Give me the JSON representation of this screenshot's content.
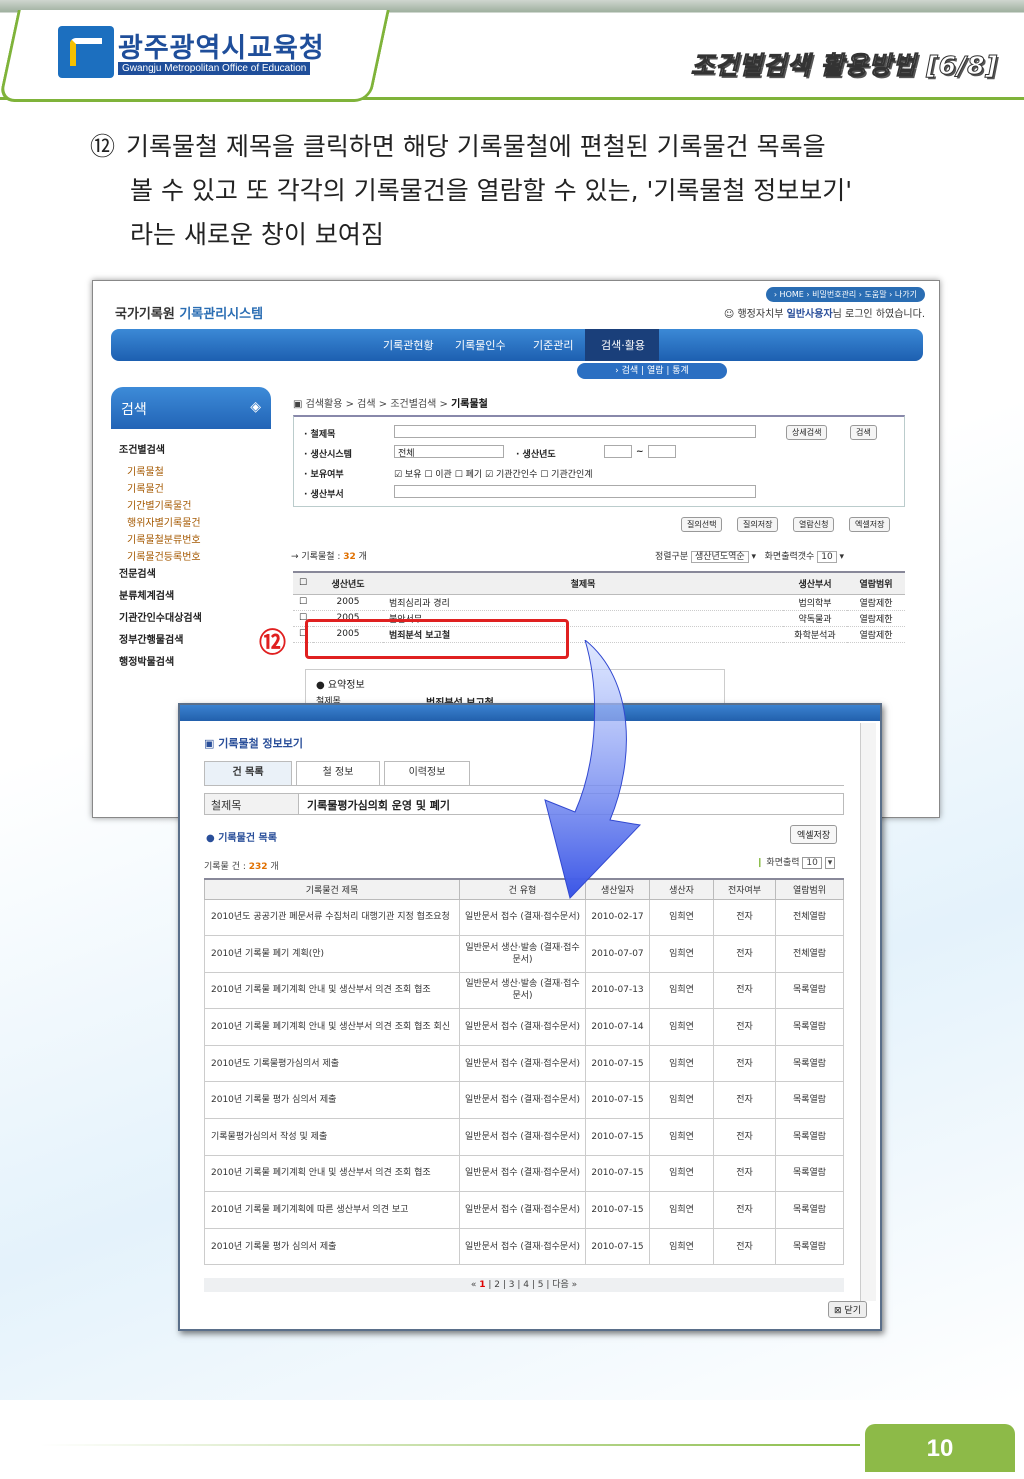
{
  "header": {
    "org_name": "광주광역시교육청",
    "org_sub": "Gwangju Metropolitan Office of Education",
    "page_title": "조건별검색 활용방법 [6/8]"
  },
  "step": {
    "number": "⑫",
    "line1": "기록물철 제목을 클릭하면 해당 기록물철에 편철된 기록물건 목록을",
    "line2": "볼 수 있고 또 각각의 기록물건을 열람할 수 있는, '기록물철 정보보기'",
    "line3": "라는 새로운 창이 보여짐"
  },
  "system": {
    "logo_a": "국가기록원",
    "logo_b": "기록관리시스템",
    "top_links": "› HOME  › 비밀번호관리  › 도움말  › 나가기",
    "user_org": "행정자치부",
    "user_name": "일반사용자",
    "user_suffix": "님 로그인 하였습니다.",
    "nav": [
      "기록관현황",
      "기록물인수",
      "기준관리",
      "검색·활용"
    ],
    "subnav": "› 검색 | 열람 | 통계",
    "side_title": "검색",
    "side_items": [
      {
        "label": "조건별검색",
        "type": "b"
      },
      {
        "label": "기록물철",
        "type": "s"
      },
      {
        "label": "기록물건",
        "type": "s"
      },
      {
        "label": "기간별기록물건",
        "type": "s"
      },
      {
        "label": "행위자별기록물건",
        "type": "s"
      },
      {
        "label": "기록물철분류번호",
        "type": "s"
      },
      {
        "label": "기록물건등록번호",
        "type": "s"
      },
      {
        "label": "전문검색",
        "type": "b"
      },
      {
        "label": "분류체계검색",
        "type": "b"
      },
      {
        "label": "기관간인수대상검색",
        "type": "b"
      },
      {
        "label": "정부간행물검색",
        "type": "b"
      },
      {
        "label": "행정박물검색",
        "type": "b"
      }
    ],
    "crumb_path": "검색활용 > 검색 > 조건별검색 > ",
    "crumb_current": "기록물철",
    "form": {
      "title_label": "· 철제목",
      "sys_label": "· 생산시스템",
      "sys_value": "전체",
      "year_label": "· 생산년도",
      "year_sep": "~",
      "hold_label": "· 보유여부",
      "hold_opts": "☑ 보유  ☐ 이관  ☐ 폐기  ☑ 기관간인수  ☐ 기관간인계",
      "dept_label": "· 생산부서",
      "detail_btn": "상세검색",
      "search_btn": "검색"
    },
    "actions": [
      "질의선택",
      "질의저장",
      "열람신청",
      "엑셀저장"
    ],
    "result_prefix": "→ 기록물철 : ",
    "result_count": "32",
    "result_unit": " 개",
    "sort_label": "정렬구분",
    "sort_value": "생산년도역순",
    "pp_label": "화면출력갯수",
    "pp_value": "10",
    "cols": [
      "생산년도",
      "철제목",
      "생산부서",
      "열람범위"
    ],
    "rows": [
      {
        "year": "2005",
        "title": "범죄심리과 경리",
        "dept": "법의학부",
        "access": "열람제한"
      },
      {
        "year": "2005",
        "title": "불안서무",
        "dept": "약독물과",
        "access": "열람제한"
      },
      {
        "year": "2005",
        "title": "범죄분석 보고철",
        "dept": "화학분석과",
        "access": "열람제한"
      }
    ],
    "summary_label": "요약정보",
    "summary_key": "철제목",
    "summary_val": "범죄분석 보고철",
    "marker": "⑫"
  },
  "popup": {
    "title": "기록물철 정보보기",
    "tabs": [
      "건 목록",
      "철 정보",
      "이력정보"
    ],
    "cheol_key": "철제목",
    "cheol_val": "기록물평가심의회 운영 및 폐기",
    "list_head": "기록물건 목록",
    "excel_btn": "엑셀저장",
    "count_prefix": "기록물 건 : ",
    "count": "232",
    "count_unit": " 개",
    "pp_label": "화면출력",
    "pp_value": "10",
    "cols": [
      "기록물건 제목",
      "건 유형",
      "생산일자",
      "생산자",
      "전자여부",
      "열람범위"
    ],
    "rows": [
      {
        "title": "2010년도 공공기관 폐문서류 수집처리 대행기관 지정 협조요청",
        "type": "일반문서 접수 (결재·접수문서)",
        "date": "2010-02-17",
        "author": "임희연",
        "elec": "전자",
        "access": "전체열람"
      },
      {
        "title": "2010년 기록물 폐기 계획(안)",
        "type": "일반문서 생산·발송 (결재·접수문서)",
        "date": "2010-07-07",
        "author": "임희연",
        "elec": "전자",
        "access": "전체열람"
      },
      {
        "title": "2010년 기록물 폐기계획 안내 및 생산부서 의견 조회 협조",
        "type": "일반문서 생산·발송 (결재·접수문서)",
        "date": "2010-07-13",
        "author": "임희연",
        "elec": "전자",
        "access": "목록열람"
      },
      {
        "title": "2010년 기록물 폐기계획 안내 및 생산부서 의견 조회 협조 회신",
        "type": "일반문서 접수 (결재·접수문서)",
        "date": "2010-07-14",
        "author": "임희연",
        "elec": "전자",
        "access": "목록열람"
      },
      {
        "title": "2010년도 기록물평가심의서 제출",
        "type": "일반문서 접수 (결재·접수문서)",
        "date": "2010-07-15",
        "author": "임희연",
        "elec": "전자",
        "access": "목록열람"
      },
      {
        "title": "2010년 기록물 평가 심의서 제출",
        "type": "일반문서 접수 (결재·접수문서)",
        "date": "2010-07-15",
        "author": "임희연",
        "elec": "전자",
        "access": "목록열람"
      },
      {
        "title": "기록물평가심의서 작성 및 제출",
        "type": "일반문서 접수 (결재·접수문서)",
        "date": "2010-07-15",
        "author": "임희연",
        "elec": "전자",
        "access": "목록열람"
      },
      {
        "title": "2010년 기록물 폐기계획 안내 및 생산부서 의견 조회 협조",
        "type": "일반문서 접수 (결재·접수문서)",
        "date": "2010-07-15",
        "author": "임희연",
        "elec": "전자",
        "access": "목록열람"
      },
      {
        "title": "2010년 기록물 폐기계획에 따른 생산부서 의견 보고",
        "type": "일반문서 접수 (결재·접수문서)",
        "date": "2010-07-15",
        "author": "임희연",
        "elec": "전자",
        "access": "목록열람"
      },
      {
        "title": "2010년 기록물 평가 심의서 제출",
        "type": "일반문서 접수 (결재·접수문서)",
        "date": "2010-07-15",
        "author": "임희연",
        "elec": "전자",
        "access": "목록열람"
      }
    ],
    "pager_pages": [
      "1",
      "2",
      "3",
      "4",
      "5"
    ],
    "pager_next": "다음",
    "close_btn": "닫기"
  },
  "footer": {
    "page_number": "10"
  }
}
